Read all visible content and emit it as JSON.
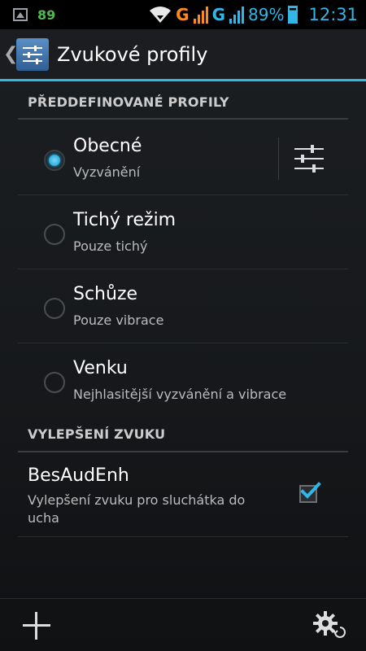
{
  "status_bar": {
    "notification_count": "89",
    "network_1": "G",
    "network_2": "G",
    "battery_percent": "89%",
    "time": "12:31",
    "colors": {
      "accent": "#33b5e5",
      "count": "#4fb84f",
      "network_1": "#ff8a1a"
    },
    "icons": [
      "gallery-icon",
      "wifi-icon",
      "signal-icon",
      "battery-icon"
    ]
  },
  "action_bar": {
    "title": "Zvukové profily",
    "icons": [
      "back-caret-icon",
      "equalizer-icon"
    ]
  },
  "predefined": {
    "header": "PŘEDDEFINOVANÉ PROFILY",
    "profiles": [
      {
        "title": "Obecné",
        "subtitle": "Vyzvánění",
        "selected": true
      },
      {
        "title": "Tichý režim",
        "subtitle": "Pouze tichý",
        "selected": false
      },
      {
        "title": "Schůze",
        "subtitle": "Pouze vibrace",
        "selected": false
      },
      {
        "title": "Venku",
        "subtitle": "Nejhlasitější vyzvánění a vibrace",
        "selected": false
      }
    ]
  },
  "enhancement": {
    "header": "VYLEPŠENÍ ZVUKU",
    "title": "BesAudEnh",
    "subtitle": "Vylepšení zvuku pro sluchátka do ucha",
    "checked": true
  },
  "bottom_bar": {
    "icons": [
      "add-icon",
      "gear-reset-icon"
    ]
  },
  "colors": {
    "background": "#16181b",
    "accent": "#33b5e5",
    "divider": "#3a3d40"
  }
}
